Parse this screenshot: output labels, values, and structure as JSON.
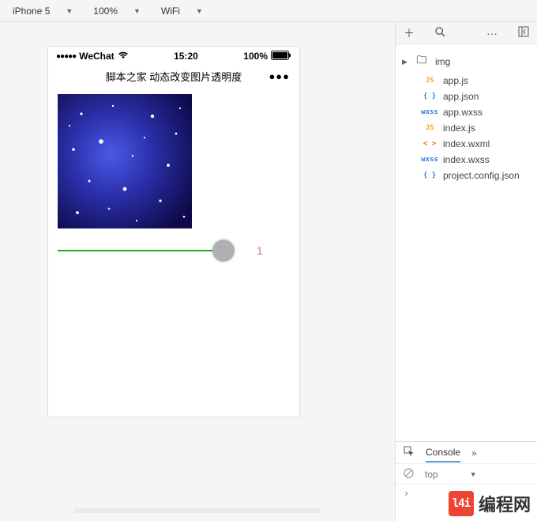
{
  "toolbar": {
    "device": "iPhone 5",
    "zoom": "100%",
    "network": "WiFi"
  },
  "simulator": {
    "carrier": "WeChat",
    "time": "15:20",
    "battery_pct": "100%",
    "page_title": "脚本之家 动态改变图片透明度",
    "slider_value": "1"
  },
  "file_tree": {
    "folder": "img",
    "files": [
      {
        "name": "app.js",
        "icon": "JS",
        "cls": "ico-js"
      },
      {
        "name": "app.json",
        "icon": "{ }",
        "cls": "ico-json"
      },
      {
        "name": "app.wxss",
        "icon": "wxss",
        "cls": "ico-wxss"
      },
      {
        "name": "index.js",
        "icon": "JS",
        "cls": "ico-js"
      },
      {
        "name": "index.wxml",
        "icon": "< >",
        "cls": "ico-wxml"
      },
      {
        "name": "index.wxss",
        "icon": "wxss",
        "cls": "ico-wxss"
      },
      {
        "name": "project.config.json",
        "icon": "{ }",
        "cls": "ico-json"
      }
    ]
  },
  "devtools": {
    "tab": "Console",
    "context": "top"
  },
  "watermark": {
    "logo": "l4i",
    "text": "编程网"
  }
}
